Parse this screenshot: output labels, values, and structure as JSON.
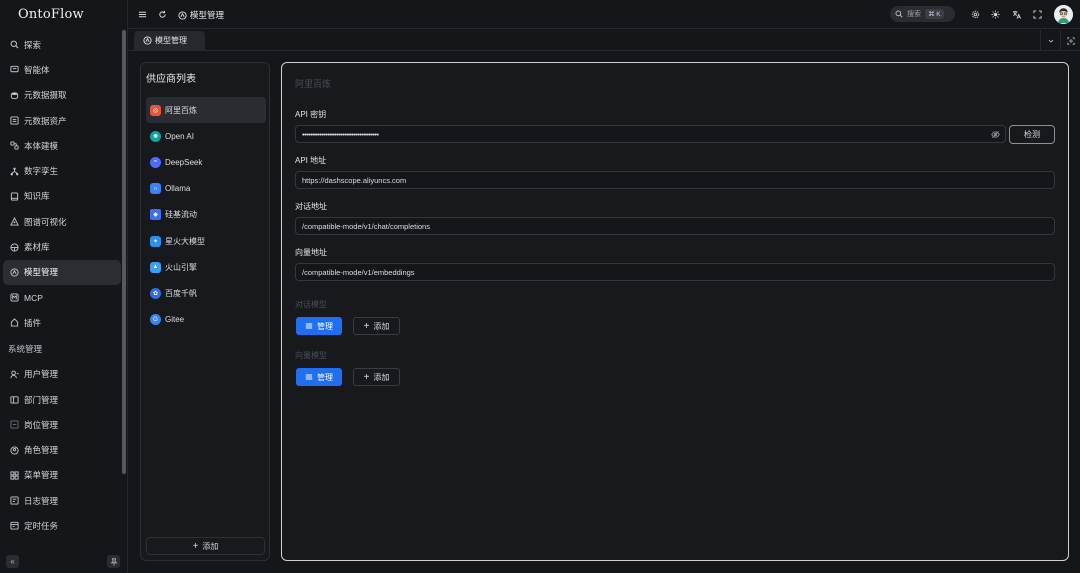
{
  "app": {
    "brand": "OntoFlow"
  },
  "sidebar": {
    "items": [
      {
        "label": "探索",
        "icon": "search-icon"
      },
      {
        "label": "智能体",
        "icon": "chat-icon"
      },
      {
        "label": "元数据摄取",
        "icon": "database-icon"
      },
      {
        "label": "元数据资产",
        "icon": "list-icon"
      },
      {
        "label": "本体建模",
        "icon": "model-icon"
      },
      {
        "label": "数字孪生",
        "icon": "network-icon"
      },
      {
        "label": "知识库",
        "icon": "book-icon"
      },
      {
        "label": "图谱可视化",
        "icon": "graph-icon"
      },
      {
        "label": "素材库",
        "icon": "layers-icon"
      },
      {
        "label": "模型管理",
        "icon": "model-manage-icon",
        "active": true
      },
      {
        "label": "MCP",
        "icon": "mcp-icon"
      },
      {
        "label": "插件",
        "icon": "plugin-icon"
      }
    ],
    "section_label": "系统管理",
    "system_items": [
      {
        "label": "用户管理",
        "icon": "user-icon"
      },
      {
        "label": "部门管理",
        "icon": "department-icon"
      },
      {
        "label": "岗位管理",
        "icon": "post-icon"
      },
      {
        "label": "角色管理",
        "icon": "role-icon"
      },
      {
        "label": "菜单管理",
        "icon": "menu-icon"
      },
      {
        "label": "日志管理",
        "icon": "log-icon"
      },
      {
        "label": "定时任务",
        "icon": "calendar-icon"
      }
    ]
  },
  "topbar": {
    "breadcrumb": "模型管理",
    "search_label": "搜索",
    "search_shortcut": "⌘ K"
  },
  "tabs": [
    {
      "label": "模型管理"
    }
  ],
  "providers": {
    "title": "供应商列表",
    "items": [
      {
        "label": "阿里百炼",
        "color": "#e8553d",
        "active": true
      },
      {
        "label": "Open AI",
        "color": "#10a3a3"
      },
      {
        "label": "DeepSeek",
        "color": "#4d6bfe"
      },
      {
        "label": "Ollama",
        "color": "#3b82f6"
      },
      {
        "label": "硅基流动",
        "color": "#3d6ef5"
      },
      {
        "label": "星火大模型",
        "color": "#2f8ff0"
      },
      {
        "label": "火山引擎",
        "color": "#3c9ef5"
      },
      {
        "label": "百度千帆",
        "color": "#2f6ee8"
      },
      {
        "label": "Gitee",
        "color": "#3b82f6"
      }
    ],
    "add_label": "添加"
  },
  "detail": {
    "title": "阿里百炼",
    "api_key_label": "API 密钥",
    "api_key_value": "••••••••••••••••••••••••••••••••••••",
    "check_label": "检测",
    "api_url_label": "API 地址",
    "api_url_value": "https://dashscope.aliyuncs.com",
    "chat_path_label": "对话地址",
    "chat_path_value": "/compatible-mode/v1/chat/completions",
    "embed_path_label": "向量地址",
    "embed_path_value": "/compatible-mode/v1/embeddings",
    "chat_model_label": "对话模型",
    "embed_model_label": "向量模型",
    "manage_label": "管理",
    "add_label": "添加"
  },
  "colors": {
    "accent": "#1f6ff2",
    "background": "#151619"
  }
}
